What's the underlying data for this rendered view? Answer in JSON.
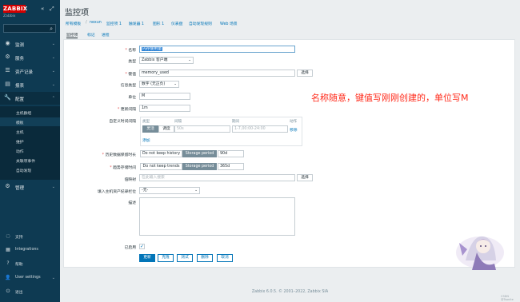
{
  "app": {
    "logo": "ZABBIX",
    "instance": "Zabbix",
    "page_title": "监控项",
    "collapse_icon": "collapse-icon",
    "kiosk_icon": "kiosk-icon"
  },
  "sidebar": {
    "menu": [
      {
        "icon": "eye-icon",
        "label": "监测"
      },
      {
        "icon": "services-icon",
        "label": "服务"
      },
      {
        "icon": "list-icon",
        "label": "资产记录"
      },
      {
        "icon": "chart-icon",
        "label": "报表"
      },
      {
        "icon": "wrench-icon",
        "label": "配置"
      },
      {
        "icon": "gear-icon",
        "label": "管理"
      }
    ],
    "submenu": [
      "主机群组",
      "模板",
      "主机",
      "维护",
      "动作",
      "关联项事件",
      "自动发现"
    ],
    "bottom": [
      {
        "icon": "support-icon",
        "label": "支持"
      },
      {
        "icon": "integrations-icon",
        "label": "Integrations"
      },
      {
        "icon": "help-icon",
        "label": "帮助"
      },
      {
        "icon": "user-icon",
        "label": "User settings"
      },
      {
        "icon": "power-icon",
        "label": "退出"
      }
    ]
  },
  "breadcrumb": [
    "所有模板",
    "nexun",
    "监控项 1",
    "触发器 1",
    "图形 1",
    "仪表盘",
    "自动发现规则",
    "Web 场景"
  ],
  "tabs": [
    "监控项",
    "标记",
    "进程"
  ],
  "form": {
    "name_label": "名称",
    "name_value": "内存使用量",
    "type_label": "类型",
    "type_value": "Zabbix 客户端",
    "key_label": "键值",
    "key_value": "memory_used",
    "select_label": "选择",
    "info_type_label": "信息类型",
    "info_type_value": "数字 (无正负)",
    "units_label": "单位",
    "units_value": "M",
    "interval_label": "更新间隔",
    "interval_value": "1m",
    "custom_intervals_label": "自定义时间间隔",
    "intervals_headers": {
      "type": "类型",
      "interval": "间隔",
      "period": "期间",
      "action": "动作"
    },
    "interval_types": [
      "灵活",
      "调度"
    ],
    "interval_placeholder": "50s",
    "period_placeholder": "1-7,00:00-24:00",
    "remove_label": "移除",
    "add_label": "添加",
    "history_label": "历史数据保留时长",
    "history_options": [
      "Do not keep history",
      "Storage period"
    ],
    "history_value": "90d",
    "trends_label": "趋势存储时间",
    "trends_options": [
      "Do not keep trends",
      "Storage period"
    ],
    "trends_value": "365d",
    "valuemap_label": "值映射",
    "valuemap_placeholder": "在此输入搜索",
    "inventory_label": "填入主机资产纪录栏位",
    "inventory_value": "-无-",
    "description_label": "描述",
    "enabled_label": "已启用",
    "buttons": [
      "更新",
      "克隆",
      "测试",
      "删除",
      "取消"
    ]
  },
  "annotation": "名称随意，键值写刚刚创建的，单位写M",
  "footer": "Zabbix 6.0.5. © 2001–2022, Zabbix SIA",
  "watermark": "CSDN @Tsanite",
  "colors": {
    "sidebar": "#0e3a52",
    "accent": "#0275b8",
    "logo": "#d40000",
    "annotation": "#ff2a1a"
  }
}
